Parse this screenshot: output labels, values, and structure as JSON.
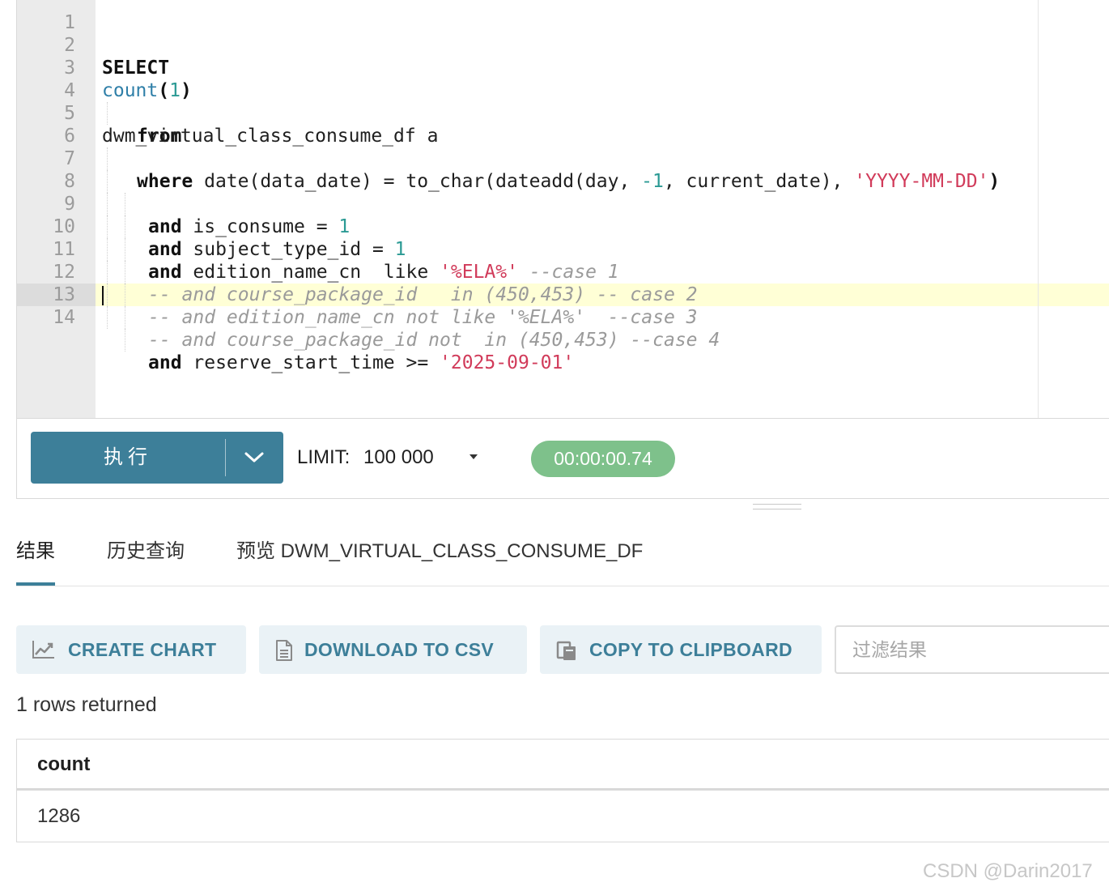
{
  "editor": {
    "lines": [
      {
        "num": "1"
      },
      {
        "num": "2"
      },
      {
        "num": "3"
      },
      {
        "num": "4"
      },
      {
        "num": "5"
      },
      {
        "num": "6"
      },
      {
        "num": "7"
      },
      {
        "num": "8"
      },
      {
        "num": "9"
      },
      {
        "num": "10"
      },
      {
        "num": "11"
      },
      {
        "num": "12"
      },
      {
        "num": "13"
      },
      {
        "num": "14"
      }
    ],
    "tokens": {
      "l2_select": "SELECT",
      "l3_count": "count",
      "l3_paren_open": "(",
      "l3_one": "1",
      "l3_paren_close": ")",
      "l4_from": "from",
      "l5_table": "dwm_virtual_class_consume_df a",
      "l6_where": "where",
      "l6_expr_a": " date(data_date) = to_char(dateadd(day, ",
      "l6_neg_one": "-1",
      "l6_expr_b": ", current_date), ",
      "l6_fmt": "'YYYY-MM-DD'",
      "l6_close": ")",
      "l7_and": "and",
      "l7_expr": " is_consume = ",
      "l7_val": "1",
      "l8_and": "and",
      "l8_expr": " subject_type_id = ",
      "l8_val": "1",
      "l9_and": "and",
      "l9_expr": " edition_name_cn  like ",
      "l9_str": "'%ELA%'",
      "l9_comment": " --case 1",
      "l10_comment": "-- and course_package_id   in (450,453) -- case 2",
      "l11_comment": "-- and edition_name_cn not like '%ELA%'  --case 3",
      "l12_comment": "-- and course_package_id not  in (450,453) --case 4",
      "l13_and": "and",
      "l13_expr": " reserve_start_time >= ",
      "l13_str": "'2025-09-01'"
    }
  },
  "toolbar": {
    "run_label": "执行",
    "limit_label": "LIMIT:",
    "limit_value": "100 000",
    "timer": "00:00:00.74"
  },
  "tabs": [
    {
      "label": "结果"
    },
    {
      "label": "历史查询"
    },
    {
      "label": "预览 DWM_VIRTUAL_CLASS_CONSUME_DF"
    }
  ],
  "actions": {
    "create_chart": "CREATE CHART",
    "download_csv": "DOWNLOAD TO CSV",
    "copy_clipboard": "COPY TO CLIPBOARD",
    "filter_placeholder": "过滤结果"
  },
  "results": {
    "rows_returned": "1 rows returned",
    "columns": [
      "count"
    ],
    "rows": [
      [
        "1286"
      ]
    ]
  },
  "watermark": "CSDN @Darin2017",
  "colors": {
    "accent": "#3d7f99",
    "timer": "#7ec18b",
    "active_line": "#ffffd6"
  }
}
